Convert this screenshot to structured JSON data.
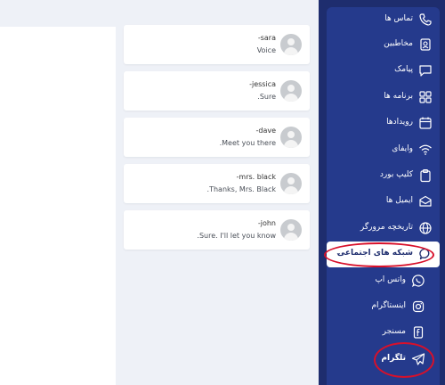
{
  "sidebar": {
    "items": [
      {
        "label": "تماس ها",
        "icon": "phone-icon"
      },
      {
        "label": "مخاطبین",
        "icon": "contacts-icon"
      },
      {
        "label": "پیامک",
        "icon": "message-icon"
      },
      {
        "label": "برنامه ها",
        "icon": "apps-grid-icon"
      },
      {
        "label": "رویدادها",
        "icon": "calendar-icon"
      },
      {
        "label": "وایفای",
        "icon": "wifi-icon"
      },
      {
        "label": "کلیپ بورد",
        "icon": "clipboard-icon"
      },
      {
        "label": "ایمیل ها",
        "icon": "email-icon"
      },
      {
        "label": "تاریخچه مرورگر",
        "icon": "globe-icon"
      },
      {
        "label": "شبکه های اجتماعی",
        "icon": "chat-bubble-icon",
        "chevron": "⌄"
      },
      {
        "label": "واتس اپ",
        "icon": "whatsapp-icon"
      },
      {
        "label": "اینستاگرام",
        "icon": "instagram-icon"
      },
      {
        "label": "مسنجر",
        "icon": "messenger-icon"
      },
      {
        "label": "تلگرام",
        "icon": "telegram-icon"
      }
    ]
  },
  "chats": [
    {
      "name": "sara-",
      "message": "Voice"
    },
    {
      "name": "jessica-",
      "message": "Sure."
    },
    {
      "name": "dave-",
      "message": "Meet you there."
    },
    {
      "name": "mrs. black-",
      "message": "Thanks, Mrs. Black."
    },
    {
      "name": "john-",
      "message": "Sure. I'll let you know."
    }
  ],
  "colors": {
    "sidebar_bg": "#253a8c",
    "highlight_ring": "#d8102a",
    "page_bg": "#eef1f7"
  }
}
